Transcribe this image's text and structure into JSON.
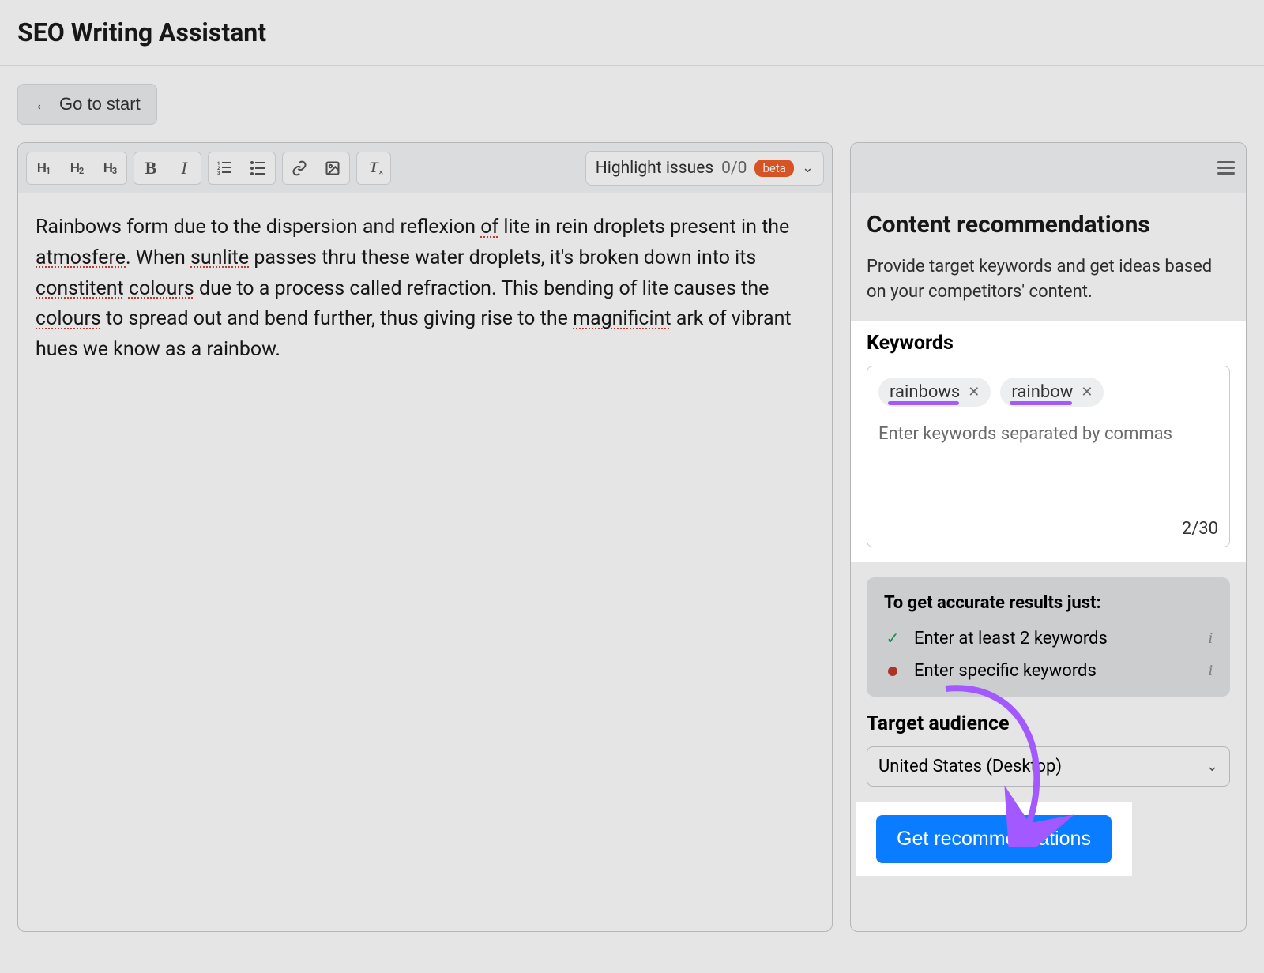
{
  "header": {
    "title": "SEO Writing Assistant"
  },
  "nav": {
    "go_to_start": "Go to start"
  },
  "toolbar": {
    "h1": "H",
    "h2": "H",
    "h3": "H",
    "highlight_label": "Highlight issues",
    "highlight_count": "0/0",
    "beta": "beta"
  },
  "editor": {
    "segments": [
      {
        "t": "Rainbows form due to the dispersion and reflexion ",
        "e": false
      },
      {
        "t": "of",
        "e": true
      },
      {
        "t": " lite in rein droplets present in the ",
        "e": false
      },
      {
        "t": "atmosfere",
        "e": true
      },
      {
        "t": ". When ",
        "e": false
      },
      {
        "t": "sunlite",
        "e": true
      },
      {
        "t": " passes thru these water droplets, it's broken down into its ",
        "e": false
      },
      {
        "t": "constitent",
        "e": true
      },
      {
        "t": " ",
        "e": false
      },
      {
        "t": "colours",
        "e": true
      },
      {
        "t": " due to a process called refraction. This bending of lite causes the ",
        "e": false
      },
      {
        "t": "colours",
        "e": true
      },
      {
        "t": " to spread out and bend further, thus giving rise to the ",
        "e": false
      },
      {
        "t": "magnificint",
        "e": true
      },
      {
        "t": " ark of vibrant hues we know as a rainbow.",
        "e": false
      }
    ]
  },
  "sidebar": {
    "title": "Content recommendations",
    "desc": "Provide target keywords and get ideas based on your competitors' content.",
    "keywords_label": "Keywords",
    "keywords": [
      "rainbows",
      "rainbow"
    ],
    "keywords_placeholder": "Enter keywords separated by commas",
    "keywords_counter": "2/30",
    "tips_title": "To get accurate results just:",
    "tips": [
      {
        "status": "check",
        "text": "Enter at least 2 keywords"
      },
      {
        "status": "dot",
        "text": "Enter specific keywords"
      }
    ],
    "target_label": "Target audience",
    "target_value": "United States (Desktop)",
    "cta": "Get recommendations"
  }
}
